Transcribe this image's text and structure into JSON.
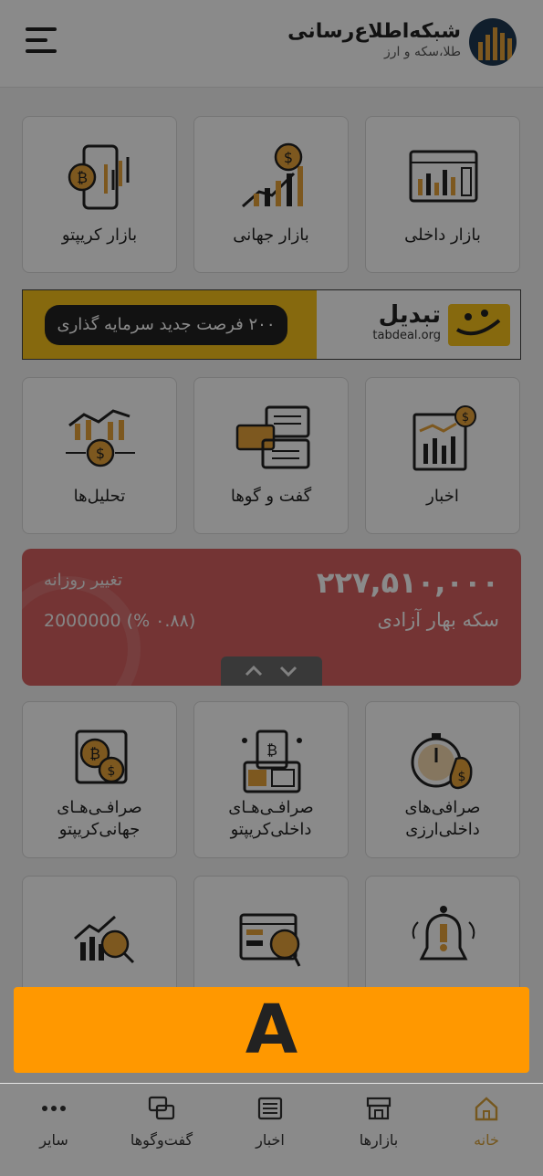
{
  "header": {
    "title": "شبکه‌اطلاع‌رسانی",
    "subtitle": "طلا،سکه و ارز"
  },
  "tiles_row1": [
    {
      "label": "بازار کریپتو",
      "icon": "crypto-phone-icon"
    },
    {
      "label": "بازار جهانی",
      "icon": "global-chart-icon"
    },
    {
      "label": "بازار داخلی",
      "icon": "domestic-dashboard-icon"
    }
  ],
  "banner": {
    "text": "۲۰۰ فرصت جدید سرمایه گذاری",
    "brand": "تبدیل",
    "domain": "tabdeal.org"
  },
  "tiles_row2": [
    {
      "label": "تحلیل‌ها",
      "icon": "analysis-icon"
    },
    {
      "label": "گفت و گوها",
      "icon": "chat-icon"
    },
    {
      "label": "اخبار",
      "icon": "news-icon"
    }
  ],
  "price_card": {
    "value": "۲۲۷,۵۱۰,۰۰۰",
    "name": "سکه بهار آزادی",
    "change_label": "تغییر روزانه",
    "change_value": "2000000 (% ۰.۸۸)",
    "color": "#d66161"
  },
  "tiles_row3": [
    {
      "label_line1": "صرافـی‌هـای",
      "label_line2": "جهانی‌کریپتو",
      "icon": "crypto-exchange-global-icon"
    },
    {
      "label_line1": "صرافـی‌هـای",
      "label_line2": "داخلی‌کریپتو",
      "icon": "crypto-exchange-local-icon"
    },
    {
      "label_line1": "صرافی‌های",
      "label_line2": "داخلی‌ارزی",
      "icon": "currency-exchange-icon"
    }
  ],
  "tiles_row4": [
    {
      "icon": "market-search-icon"
    },
    {
      "icon": "report-search-icon"
    },
    {
      "icon": "alert-bell-icon"
    }
  ],
  "ad": {
    "label": "A",
    "color": "#ff9800"
  },
  "bottom_nav": [
    {
      "label": "سایر",
      "icon": "more-icon"
    },
    {
      "label": "گفت‌وگوها",
      "icon": "chat-bubbles-icon"
    },
    {
      "label": "اخبار",
      "icon": "newspaper-icon"
    },
    {
      "label": "بازارها",
      "icon": "store-icon"
    },
    {
      "label": "خانه",
      "icon": "home-icon"
    }
  ]
}
